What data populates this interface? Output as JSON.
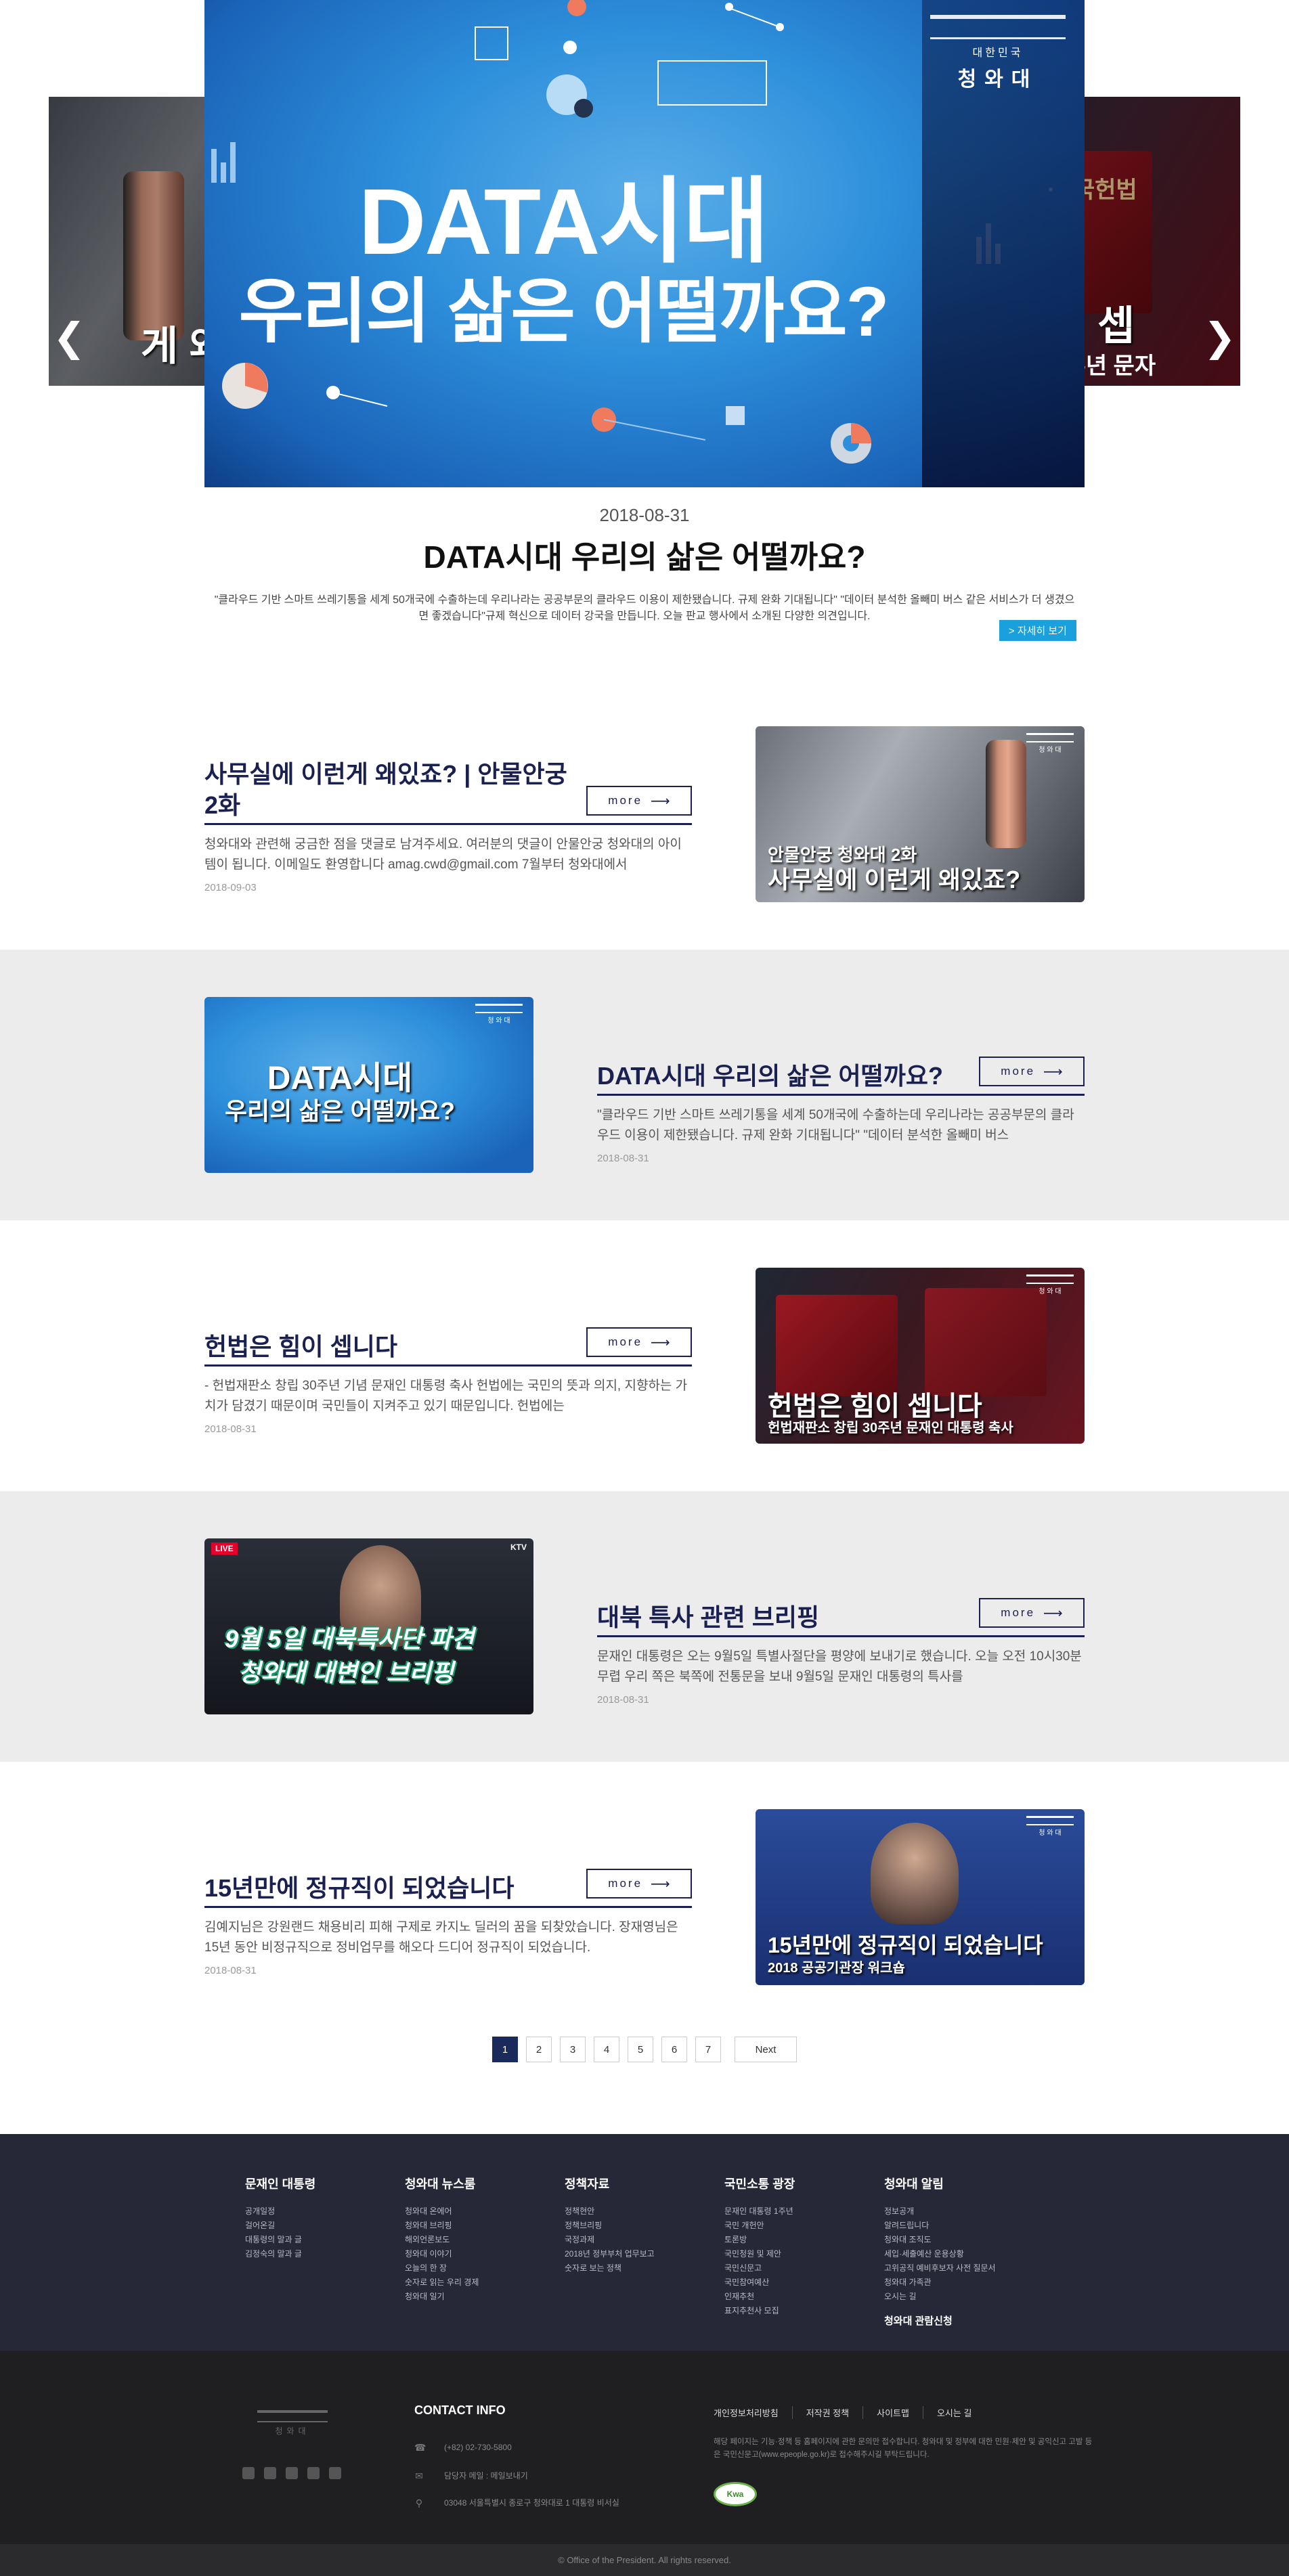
{
  "hero": {
    "main_title_line1": "DATA시대",
    "main_title_line2": "우리의 삶은 어떨까요?",
    "logo_sub": "대한민국",
    "logo_name": "청와대",
    "left_side_text": "게 왜있죠?",
    "right_side_text": "은 힘이 셉",
    "right_side_sub": "소 창립 30주년 문자",
    "right_book_label": "대한민국헌법"
  },
  "featured": {
    "date": "2018-08-31",
    "title": "DATA시대 우리의 삶은 어떨까요?",
    "description": "\"클라우드 기반 스마트 쓰레기통을 세계 50개국에 수출하는데 우리나라는 공공부문의 클라우드 이용이 제한됐습니다. 규제 완화 기대됩니다\" \"데이터 분석한 올빼미 버스 같은 서비스가 더 생겼으면 좋겠습니다\"규제 혁신으로 데이터 강국을 만듭니다. 오늘 판교 행사에서 소개된 다양한 의견입니다.",
    "detail_button": "> 자세히 보기"
  },
  "posts": [
    {
      "title": "사무실에 이런게 왜있죠? | 안물안궁 2화",
      "more": "more",
      "description": "청와대와 관련해 궁금한 점을 댓글로 남겨주세요. 여러분의 댓글이 안물안궁 청와대의 아이템이 됩니다. 이메일도 환영합니다 amag.cwd@gmail.com 7월부터 청와대에서",
      "date": "2018-09-03",
      "thumb_line1": "안물안궁 청와대 2화",
      "thumb_line2": "사무실에 이런게 왜있죠?"
    },
    {
      "title": "DATA시대 우리의 삶은 어떨까요?",
      "more": "more",
      "description": "\"클라우드 기반 스마트 쓰레기통을 세계 50개국에 수출하는데 우리나라는 공공부문의 클라우드 이용이 제한됐습니다. 규제 완화 기대됩니다\" \"데이터 분석한 올빼미 버스",
      "date": "2018-08-31",
      "thumb_line1": "DATA시대",
      "thumb_line2": "우리의 삶은 어떨까요?"
    },
    {
      "title": "헌법은 힘이 셉니다",
      "more": "more",
      "description": "- 헌법재판소 창립 30주년 기념 문재인 대통령 축사 헌법에는 국민의 뜻과 의지, 지향하는 가치가 담겼기 때문이며 국민들이 지켜주고 있기 때문입니다. 헌법에는",
      "date": "2018-08-31",
      "thumb_line1": "헌법은 힘이 셉니다",
      "thumb_line2": "헌법재판소 창립 30주년 문재인 대통령 축사"
    },
    {
      "title": "대북 특사 관련 브리핑",
      "more": "more",
      "description": "문재인 대통령은 오는 9월5일 특별사절단을 평양에 보내기로 했습니다. 오늘 오전 10시30분 무렵 우리 쪽은 북쪽에 전통문을 보내 9월5일 문재인 대통령의 특사를",
      "date": "2018-08-31",
      "thumb_line1": "9월 5일 대북특사단 파견",
      "thumb_line2": "청와대 대변인 브리핑",
      "thumb_live": "LIVE",
      "thumb_ktv": "KTV"
    },
    {
      "title": "15년만에 정규직이 되었습니다",
      "more": "more",
      "description": "김예지님은 강원랜드 채용비리 피해 구제로 카지노 딜러의 꿈을 되찾았습니다. 장재영님은 15년 동안 비정규직으로 정비업무를 해오다 드디어 정규직이 되었습니다.",
      "date": "2018-08-31",
      "thumb_line1": "15년만에 정규직이 되었습니다",
      "thumb_line2": "2018 공공기관장 워크숍"
    }
  ],
  "pagination": {
    "pages": [
      "1",
      "2",
      "3",
      "4",
      "5",
      "6",
      "7"
    ],
    "active": "1",
    "next": "Next"
  },
  "footer_nav": [
    {
      "title": "문재인 대통령",
      "items": [
        "공개일정",
        "걸어온길",
        "대통령의 말과 글",
        "김정숙의 말과 글"
      ]
    },
    {
      "title": "청와대 뉴스룸",
      "items": [
        "청와대 온에어",
        "청와대 브리핑",
        "해외언론보도",
        "청와대 이야기",
        "오늘의 한 장",
        "숫자로 읽는 우리 경제",
        "청와대 일기"
      ]
    },
    {
      "title": "정책자료",
      "items": [
        "정책현안",
        "정책브리핑",
        "국정과제",
        "2018년 정부부처 업무보고",
        "숫자로 보는 정책"
      ]
    },
    {
      "title": "국민소통 광장",
      "items": [
        "문재인 대통령 1주년",
        "국민 개헌안",
        "토론방",
        "국민청원 및 제안",
        "국민신문고",
        "국민참여예산",
        "인재추천",
        "표지추천사 모집"
      ]
    },
    {
      "title": "청와대 알림",
      "items": [
        "정보공개",
        "알려드립니다",
        "청와대 조직도",
        "세입·세출예산 운용상황",
        "고위공직 예비후보자 사전 질문서",
        "청와대 가족관",
        "오시는 길"
      ],
      "extra": "청와대 관람신청"
    }
  ],
  "footer_info": {
    "logo_name": "청와대",
    "contact_title": "CONTACT INFO",
    "phone": "(+82) 02-730-5800",
    "email": "담당자 메일 : 메일보내기",
    "address": "03048 서울특별시 종로구 청와대로 1 대통령 비서실",
    "links": [
      "개인정보처리방침",
      "저작권 정책",
      "사이트맵",
      "오시는 길"
    ],
    "notice": "해당 페이지는 기능·정책 등 홈페이지에 관한 문의만 접수합니다. 청와대 및 정부에 대한 민원·제안 및 공익신고 고발 등은 국민신문고(www.epeople.go.kr)로 접수해주시길 부탁드립니다.",
    "badge": "Kwa"
  },
  "copyright": "© Office of the President. All rights reserved."
}
